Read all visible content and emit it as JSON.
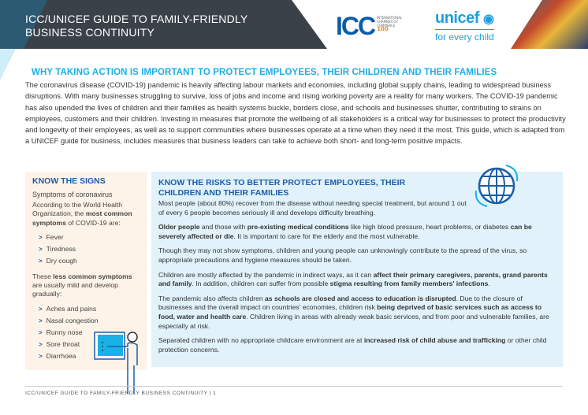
{
  "header": {
    "title_line1": "ICC/UNICEF GUIDE TO FAMILY-FRIENDLY",
    "title_line2": "BUSINESS CONTINUITY",
    "icc_logo": "ICC",
    "icc_sub": "INTERNATIONAL CHAMBER OF COMMERCE",
    "icc_badge": "100",
    "unicef_name": "unicef",
    "unicef_tagline": "for every child"
  },
  "main": {
    "heading": "WHY TAKING ACTION IS IMPORTANT TO PROTECT EMPLOYEES, THEIR CHILDREN AND THEIR FAMILIES",
    "intro": "The coronavirus disease (COVID-19) pandemic is heavily affecting labour markets and economies, including global supply chains, leading to widespread business disruptions. With many businesses struggling to survive, loss of jobs and income and rising working poverty are a reality for many workers. The COVID-19 pandemic has also upended the lives of children and their families as health systems buckle, borders close, and schools and businesses shutter, contributing to strains on employees, customers and their children. Investing in measures that promote the wellbeing of all stakeholders is a critical way for businesses to protect the productivity and longevity of their employees, as well as to support communities where businesses operate at a time when they need it the most. This guide, which is adapted from a UNICEF guide for business, includes measures that business leaders can take to achieve both short- and long-term positive impacts."
  },
  "signs": {
    "heading": "KNOW THE SIGNS",
    "subheading": "Symptoms of coronavirus",
    "p1": [
      {
        "t": "According to the World Health Organization, the "
      },
      {
        "t": "most common symptoms",
        "b": true
      },
      {
        "t": " of COVID-19 are:"
      }
    ],
    "common": [
      "Fever",
      "Tiredness",
      "Dry cough"
    ],
    "p2": [
      {
        "t": "These "
      },
      {
        "t": "less common symptoms",
        "b": true
      },
      {
        "t": " are usually mild and develop gradually:"
      }
    ],
    "less_common": [
      "Aches and pains",
      "Nasal congestion",
      "Runny nose",
      "Sore throat",
      "Diarrhoea"
    ],
    "bullet": ">"
  },
  "risks": {
    "heading": "KNOW THE RISKS TO BETTER PROTECT EMPLOYEES, THEIR CHILDREN AND THEIR FAMILIES",
    "paragraphs": [
      [
        {
          "t": "Most people (about 80%) recover from the disease without needing special treatment, but around 1 out of every 6 people becomes seriously ill and develops difficulty breathing."
        }
      ],
      [
        {
          "t": "Older people",
          "b": true
        },
        {
          "t": " and those with "
        },
        {
          "t": "pre-existing medical conditions",
          "b": true
        },
        {
          "t": " like high blood pressure, heart problems, or diabetes "
        },
        {
          "t": "can be severely affected or die",
          "b": true
        },
        {
          "t": ". It is important to care for the elderly and the most vulnerable."
        }
      ],
      [
        {
          "t": "Though they may not show symptoms, children and young people can unknowingly contribute to the spread of the virus, so appropriate precautions and hygiene measures should be taken."
        }
      ],
      [
        {
          "t": "Children are mostly affected by the pandemic in indirect ways, as it can "
        },
        {
          "t": "affect their primary caregivers, parents, grand parents and family",
          "b": true
        },
        {
          "t": ". In addition, children can suffer from possible "
        },
        {
          "t": "stigma resulting from family members' infections",
          "b": true
        },
        {
          "t": "."
        }
      ],
      [
        {
          "t": "The pandemic also affects children "
        },
        {
          "t": "as schools are closed and access to education is disrupted",
          "b": true
        },
        {
          "t": ". Due to the closure of businesses and the overall impact on countries' economies, children risk "
        },
        {
          "t": "being deprived of basic services such as access to food, water and health care",
          "b": true
        },
        {
          "t": ". Children living in areas with already weak basic services, and from poor and vulnerable families, are especially at risk."
        }
      ],
      [
        {
          "t": "Separated children with no appropriate childcare environment are at "
        },
        {
          "t": "increased risk of child abuse and trafficking",
          "b": true
        },
        {
          "t": " or other child protection concerns."
        }
      ]
    ]
  },
  "footer": {
    "text": "ICC/UNICEF GUIDE TO FAMILY-FRIENDLY BUSINESS CONTINUITY  |  1"
  },
  "colors": {
    "header_bg": "#3a4149",
    "heading_cyan": "#1ab0e8",
    "box_heading_blue": "#1c5ea8",
    "signs_bg": "#fdf3e8",
    "risks_bg": "#e1f2fb"
  },
  "icons": [
    "globe-icon",
    "presenter-icon",
    "chevron-right-icon"
  ]
}
